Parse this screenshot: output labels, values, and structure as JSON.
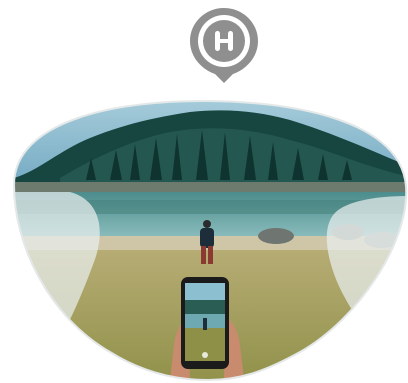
{
  "brand": {
    "logo_icon": "h-location-pin-icon",
    "logo_color": "#8f8f8f"
  },
  "illustration": {
    "subject": "lens-shaped-photo-icon",
    "palette": {
      "sky": "#7fb3c9",
      "forest_dark": "#153f3b",
      "forest_mid": "#2d6a62",
      "lake": "#6ea9b2",
      "shore": "#c9c1a3",
      "grass": "#9a9a4d",
      "frame": "#e8ecec"
    }
  }
}
